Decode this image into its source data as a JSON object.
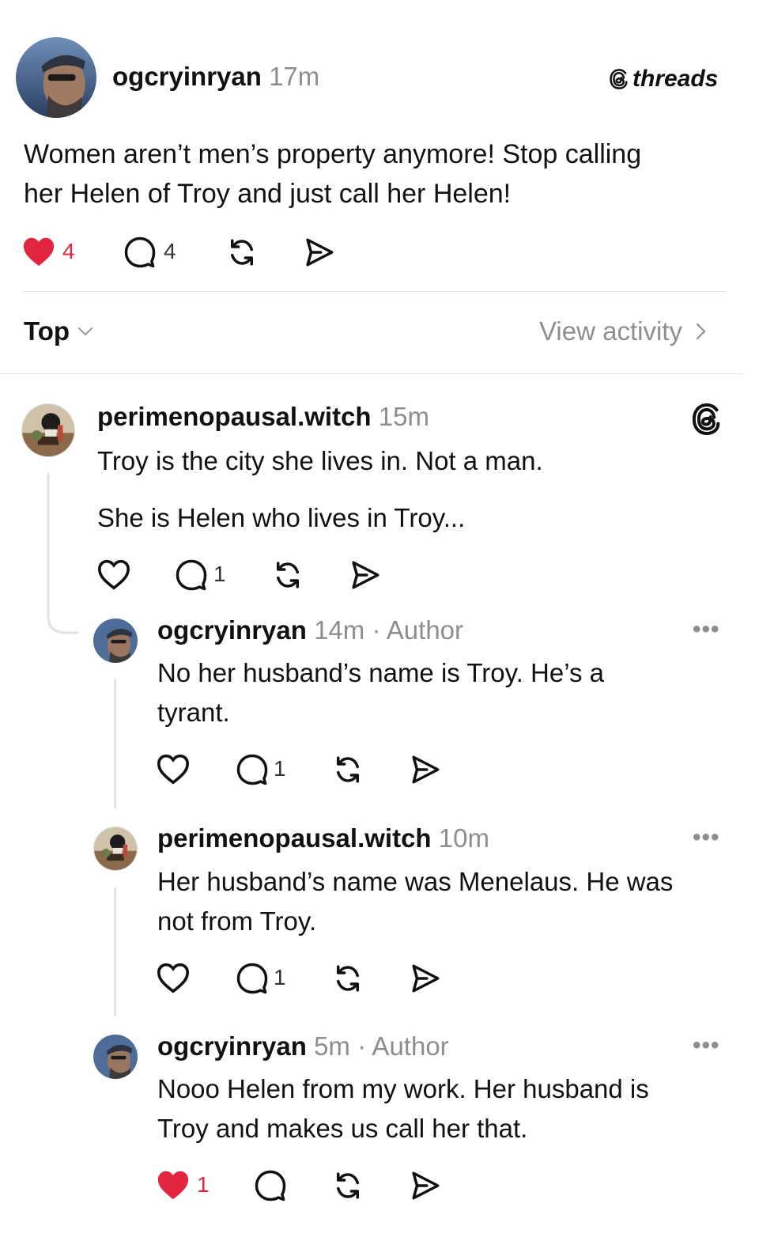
{
  "post": {
    "username": "ogcryinryan",
    "time": "17m",
    "brand": "threads",
    "text_line1": "Women aren’t men’s property anymore! Stop calling",
    "text_line2": "her Helen of Troy and just call her Helen!",
    "likes": "4",
    "comments": "4",
    "liked": true
  },
  "sort": {
    "label": "Top",
    "view_activity": "View activity"
  },
  "replies": [
    {
      "username": "perimenopausal.witch",
      "time": "15m",
      "author_tag": "",
      "line1": "Troy is the city she lives in. Not a man.",
      "line2": "She is Helen who lives in Troy...",
      "comments": "1"
    },
    {
      "username": "ogcryinryan",
      "time": "14m",
      "author_tag": "· Author",
      "line1": "No her husband’s name is Troy. He’s a",
      "line2": "tyrant.",
      "comments": "1"
    },
    {
      "username": "perimenopausal.witch",
      "time": "10m",
      "author_tag": "",
      "line1": "Her husband’s name was Menelaus. He was",
      "line2": "not from Troy.",
      "comments": "1"
    },
    {
      "username": "ogcryinryan",
      "time": "5m",
      "author_tag": "· Author",
      "line1": "Nooo Helen from my work. Her husband is",
      "line2": "Troy and makes us call her that.",
      "likes": "1",
      "liked": true
    }
  ],
  "colors": {
    "like_red": "#e4253f",
    "meta_gray": "#8e8e8e",
    "text": "#111111"
  },
  "icons": [
    "heart-icon",
    "comment-icon",
    "repost-icon",
    "share-icon",
    "threads-logo-icon",
    "chevron-down-icon",
    "chevron-right-icon",
    "more-icon"
  ]
}
